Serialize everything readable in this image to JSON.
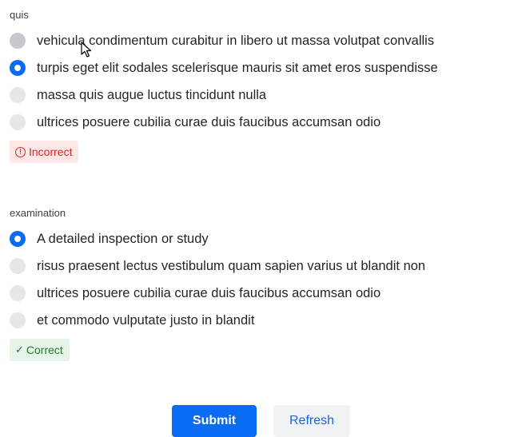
{
  "questions": [
    {
      "label": "quis",
      "options": [
        "vehicula condimentum curabitur in libero ut massa volutpat convallis",
        "turpis eget elit sodales scelerisque mauris sit amet eros suspendisse",
        "massa quis augue luctus tincidunt nulla",
        "ultrices posuere cubilia curae duis faucibus accumsan odio"
      ],
      "selected_index": 1,
      "feedback": "Incorrect"
    },
    {
      "label": "examination",
      "options": [
        "A detailed inspection or study",
        "risus praesent lectus vestibulum quam sapien varius ut blandit non",
        "ultrices posuere cubilia curae duis faucibus accumsan odio",
        "et commodo vulputate justo in blandit"
      ],
      "selected_index": 0,
      "feedback": "Correct"
    }
  ],
  "buttons": {
    "submit_label": "Submit",
    "refresh_label": "Refresh"
  },
  "colors": {
    "accent": "#0a6cf5",
    "incorrect_text": "#e02424",
    "incorrect_bg": "#fde8e8",
    "correct_text": "#1e7a34",
    "correct_bg": "#e6f4ea"
  }
}
